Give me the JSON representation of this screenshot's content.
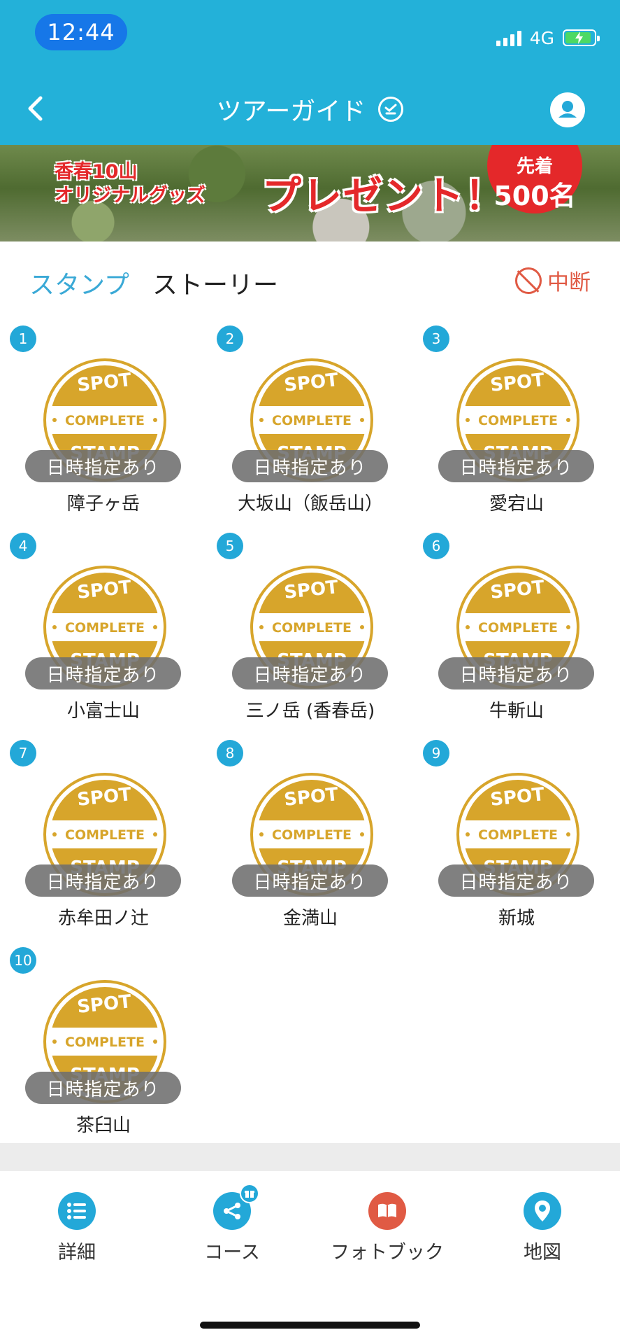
{
  "status_bar": {
    "time": "12:44",
    "network": "4G"
  },
  "nav": {
    "title": "ツアーガイド"
  },
  "banner": {
    "line1": "香春10山",
    "line2": "オリジナルグッズ",
    "main": "プレゼント！",
    "badge_top": "先着",
    "badge_bottom": "500名"
  },
  "tabs": {
    "stamp": "スタンプ",
    "story": "ストーリー"
  },
  "pause": {
    "label": "中断"
  },
  "stamp_texts": {
    "spot": "SPOT",
    "complete": "COMPLETE",
    "stamp": "STAMP"
  },
  "spots": [
    {
      "num": "1",
      "name": "障子ヶ岳",
      "badge": "日時指定あり"
    },
    {
      "num": "2",
      "name": "大坂山（飯岳山）",
      "badge": "日時指定あり"
    },
    {
      "num": "3",
      "name": "愛宕山",
      "badge": "日時指定あり"
    },
    {
      "num": "4",
      "name": "小富士山",
      "badge": "日時指定あり"
    },
    {
      "num": "5",
      "name": "三ノ岳 (香春岳)",
      "badge": "日時指定あり"
    },
    {
      "num": "6",
      "name": "牛斬山",
      "badge": "日時指定あり"
    },
    {
      "num": "7",
      "name": "赤牟田ノ辻",
      "badge": "日時指定あり"
    },
    {
      "num": "8",
      "name": "金満山",
      "badge": "日時指定あり"
    },
    {
      "num": "9",
      "name": "新城",
      "badge": "日時指定あり"
    },
    {
      "num": "10",
      "name": "茶臼山",
      "badge": "日時指定あり"
    }
  ],
  "tabbar": [
    {
      "label": "詳細",
      "icon": "list-icon",
      "color": "#23a8d8"
    },
    {
      "label": "コース",
      "icon": "share-icon",
      "color": "#23a8d8"
    },
    {
      "label": "フォトブック",
      "icon": "book-icon",
      "color": "#e05a44"
    },
    {
      "label": "地図",
      "icon": "map-pin-icon",
      "color": "#23a8d8"
    }
  ],
  "colors": {
    "header": "#23b1d9",
    "stamp_gold": "#d7a52b",
    "pause": "#e05a44"
  }
}
